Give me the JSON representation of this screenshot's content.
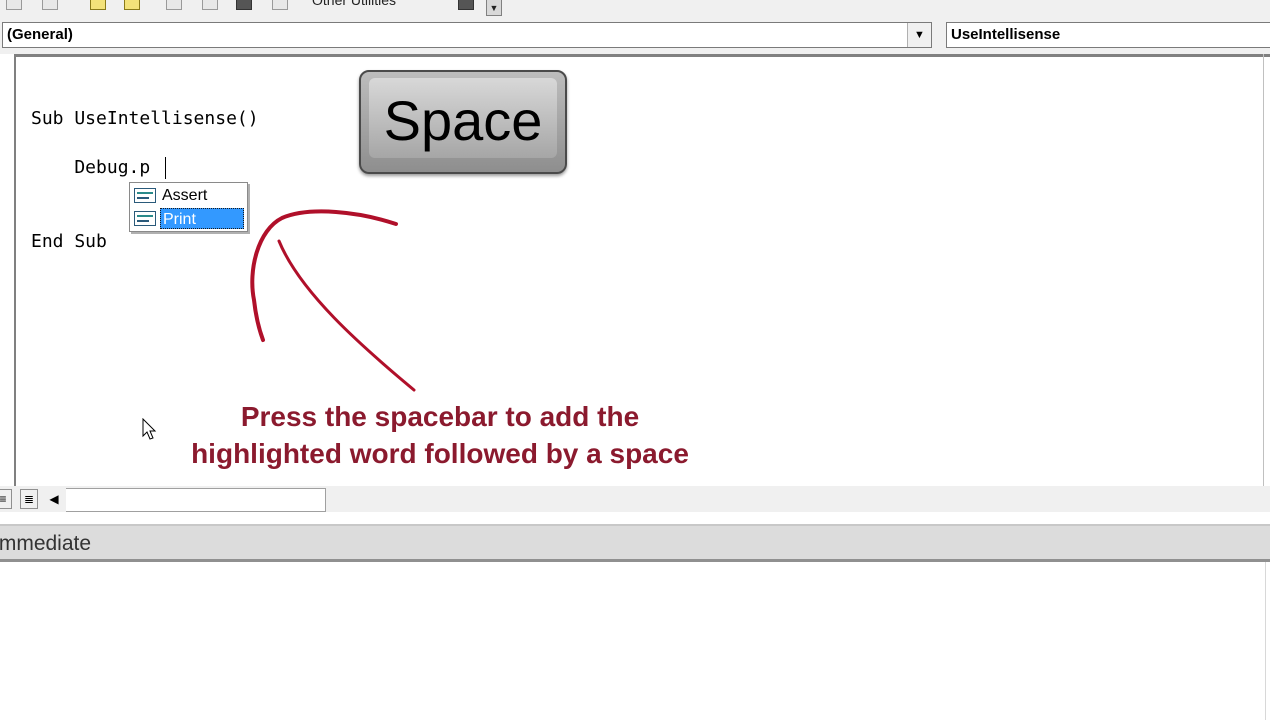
{
  "toolbar": {
    "label": "Other Utilities",
    "dropdown_icon": "chevron-down-icon"
  },
  "object_combo": {
    "value": "(General)",
    "button_glyph": "▼"
  },
  "procedure_combo": {
    "value": "UseIntellisense"
  },
  "code": {
    "line1": "Sub UseIntellisense()",
    "line2": "    Debug.p",
    "line3": "End Sub"
  },
  "intellisense": {
    "items": [
      {
        "label": "Assert",
        "selected": false
      },
      {
        "label": "Print",
        "selected": true
      }
    ]
  },
  "key_overlay": {
    "label": "Space"
  },
  "annotation": {
    "line1": "Press the spacebar to add the",
    "line2": "highlighted word followed by a space",
    "color": "#8b1a2e"
  },
  "scrollbar": {
    "left_arrow": "◀"
  },
  "immediate": {
    "title": "Immediate"
  }
}
